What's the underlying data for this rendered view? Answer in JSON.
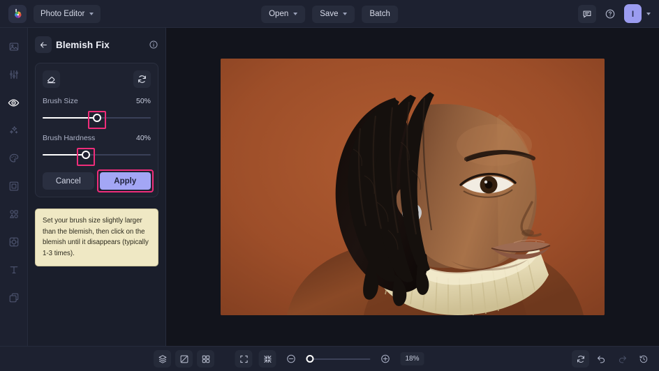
{
  "topbar": {
    "logo_icon": "color-wheel-logo",
    "app_name": "Photo Editor",
    "open_label": "Open",
    "save_label": "Save",
    "batch_label": "Batch",
    "comment_icon": "comment-icon",
    "help_icon": "help-circle-icon",
    "avatar_initial": "I"
  },
  "rail": {
    "items": [
      {
        "name": "image",
        "icon": "image-icon",
        "active": false
      },
      {
        "name": "adjust",
        "icon": "sliders-icon",
        "active": false
      },
      {
        "name": "retouch",
        "icon": "eye-icon",
        "active": true
      },
      {
        "name": "enhance",
        "icon": "sparkles-icon",
        "active": false
      },
      {
        "name": "color",
        "icon": "palette-icon",
        "active": false
      },
      {
        "name": "crop",
        "icon": "frame-icon",
        "active": false
      },
      {
        "name": "shapes",
        "icon": "shapes-icon",
        "active": false
      },
      {
        "name": "effects",
        "icon": "effects-icon",
        "active": false
      },
      {
        "name": "text",
        "icon": "text-icon",
        "active": false
      },
      {
        "name": "layers",
        "icon": "layers-stack-icon",
        "active": false
      }
    ]
  },
  "panel": {
    "back_icon": "arrow-left-icon",
    "title": "Blemish Fix",
    "info_icon": "info-circle-icon",
    "eraser_icon": "eraser-icon",
    "reset_icon": "reset-icon",
    "sliders": [
      {
        "label": "Brush Size",
        "value_label": "50%",
        "percent": 50
      },
      {
        "label": "Brush Hardness",
        "value_label": "40%",
        "percent": 40
      }
    ],
    "cancel_label": "Cancel",
    "apply_label": "Apply",
    "tip_text": "Set your brush size slightly larger than the blemish, then click on the blemish until it disappears (typically 1-3 times).",
    "highlight_color": "#ef2d7a",
    "apply_color": "#a3a6f5",
    "tip_bg": "#efe8c4"
  },
  "canvas": {
    "photo_alt": "Portrait of a woman with locs wearing a cream turtleneck on a terracotta background",
    "backdrop_color": "#9e4f2c",
    "turtleneck_color": "#e8dfc0"
  },
  "bottombar": {
    "layers_icon": "layers-icon",
    "compare_icon": "compare-split-icon",
    "grid_icon": "grid-icon",
    "fit_icon": "fit-screen-icon",
    "collapse_icon": "collapse-arrows-icon",
    "zoom_out_icon": "zoom-out-icon",
    "zoom_in_icon": "zoom-in-icon",
    "zoom_value": "18%",
    "zoom_percent": 0,
    "reset_view_icon": "reset-view-icon",
    "undo_icon": "undo-icon",
    "redo_icon": "redo-icon",
    "history_icon": "history-clock-icon"
  }
}
